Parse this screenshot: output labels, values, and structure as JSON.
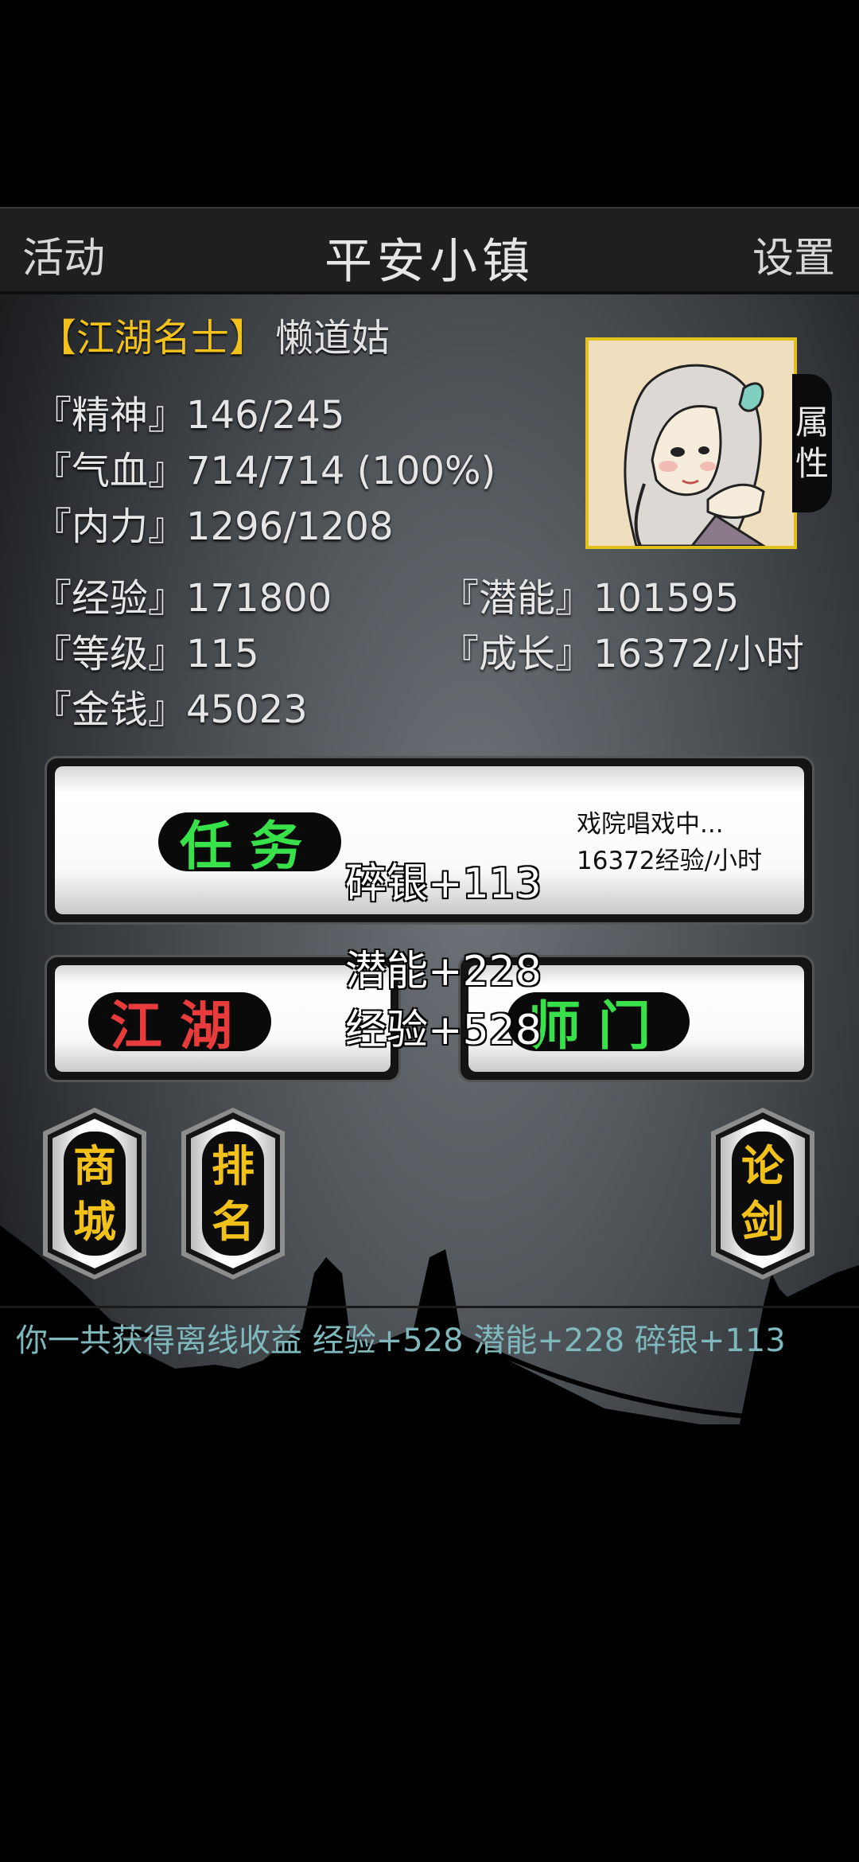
{
  "colors": {
    "title_gold": "#f2c21a",
    "task_green": "#38e04a",
    "jianghu_red": "#e83c3c",
    "shimen_green": "#38e04a",
    "log_teal": "#7fb8bc"
  },
  "header": {
    "left": "活动",
    "title": "平安小镇",
    "right": "设置"
  },
  "player": {
    "title_badge": "【江湖名士】",
    "name": "懒道姑"
  },
  "stats": {
    "jingshen": "『精神』146/245",
    "qixue": "『气血』714/714 (100%)",
    "neili": "『内力』1296/1208",
    "jingyan": "『经验』171800",
    "qianneng": "『潜能』101595",
    "dengji": "『等级』115",
    "chengzhang": "『成长』16372/小时",
    "jinqian": "『金钱』45023"
  },
  "attr_tab": {
    "line1": "属",
    "line2": "性"
  },
  "task": {
    "label": "任务",
    "status": "戏院唱戏中...",
    "rate": "16372经验/小时"
  },
  "jianghu": {
    "label": "江湖"
  },
  "shimen": {
    "label": "师门"
  },
  "floats": {
    "suiyin": "碎银+113",
    "qianneng": "潜能+228",
    "jingyan": "经验+528"
  },
  "shop": {
    "c1": "商",
    "c2": "城"
  },
  "rank": {
    "c1": "排",
    "c2": "名"
  },
  "duel": {
    "c1": "论",
    "c2": "剑"
  },
  "log": "你一共获得离线收益 经验+528 潜能+228 碎银+113",
  "icons": {
    "portrait": "character-portrait",
    "skyline": "town-skyline-silhouette"
  }
}
